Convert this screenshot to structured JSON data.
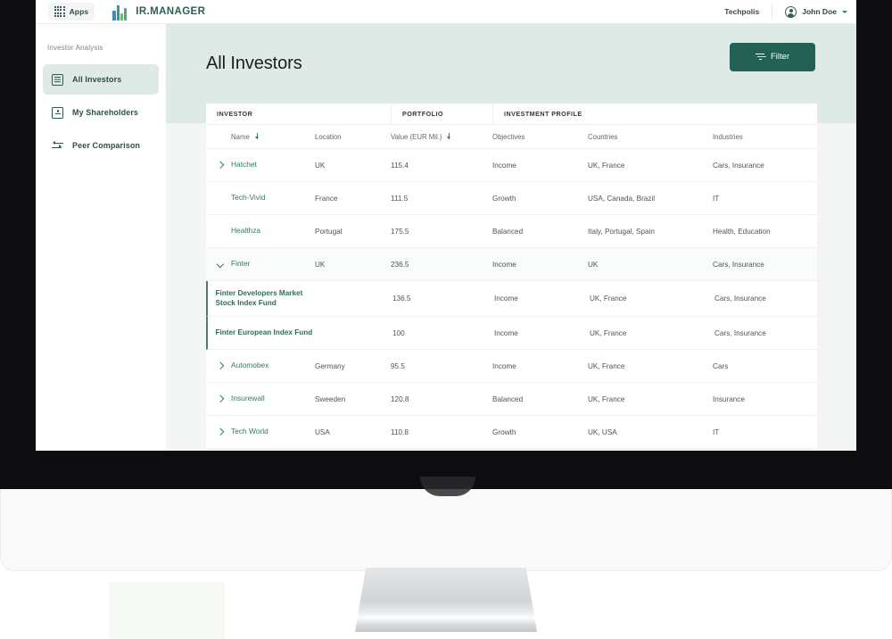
{
  "topnav": {
    "apps_label": "Apps",
    "brand_name": "IR.MANAGER",
    "org_name": "Techpolis",
    "user_name": "John Doe"
  },
  "sidebar": {
    "section_title": "Investor Analysis",
    "items": [
      {
        "label": "All Investors",
        "icon": "list-icon",
        "active": true
      },
      {
        "label": "My Shareholders",
        "icon": "document-person-icon",
        "active": false
      },
      {
        "label": "Peer Comparison",
        "icon": "compare-arrows-icon",
        "active": false
      }
    ]
  },
  "main": {
    "page_title": "All Investors",
    "filter_button": "Filter"
  },
  "table": {
    "group_headers": [
      "INVESTOR",
      "PORTFOLIO",
      "INVESTMENT PROFILE"
    ],
    "columns": [
      {
        "label": "Name",
        "sortable": true
      },
      {
        "label": "Location",
        "sortable": false
      },
      {
        "label": "Value (EUR Mil.)",
        "sortable": true
      },
      {
        "label": "Objectives",
        "sortable": false
      },
      {
        "label": "Countries",
        "sortable": false
      },
      {
        "label": "Industries",
        "sortable": false
      }
    ],
    "rows": [
      {
        "name": "Hatchet",
        "location": "UK",
        "value": "115.4",
        "objectives": "Income",
        "countries": "UK, France",
        "industries": "Cars, Insurance",
        "state": "collapsed",
        "level": 0
      },
      {
        "name": "Tech-Vivid",
        "location": "France",
        "value": "111.5",
        "objectives": "Growth",
        "countries": "USA, Canada, Brazil",
        "industries": "IT",
        "state": "none",
        "level": 0
      },
      {
        "name": "Healthza",
        "location": "Portugal",
        "value": "175.5",
        "objectives": "Balanced",
        "countries": "Italy, Portugal, Spain",
        "industries": "Health, Education",
        "state": "none",
        "level": 0
      },
      {
        "name": "Finter",
        "location": "UK",
        "value": "236.5",
        "objectives": "Income",
        "countries": "UK",
        "industries": "Cars, Insurance",
        "state": "expanded",
        "level": 0
      },
      {
        "name": "Finter Developers Market Stock Index Fund",
        "location": "",
        "value": "136.5",
        "objectives": "Income",
        "countries": "UK, France",
        "industries": "Cars, Insurance",
        "state": "none",
        "level": 1
      },
      {
        "name": "Finter European Index Fund",
        "location": "",
        "value": "100",
        "objectives": "Income",
        "countries": "UK, France",
        "industries": "Cars, Insurance",
        "state": "none",
        "level": 1
      },
      {
        "name": "Automobex",
        "location": "Germany",
        "value": "95.5",
        "objectives": "Income",
        "countries": "UK, France",
        "industries": "Cars",
        "state": "collapsed",
        "level": 0
      },
      {
        "name": "Insurewall",
        "location": "Sweeden",
        "value": "120.8",
        "objectives": "Balanced",
        "countries": "UK, France",
        "industries": "Insurance",
        "state": "collapsed",
        "level": 0
      },
      {
        "name": "Tech World",
        "location": "USA",
        "value": "110.8",
        "objectives": "Growth",
        "countries": "UK, USA",
        "industries": "IT",
        "state": "collapsed",
        "level": 0
      }
    ]
  },
  "colors": {
    "accent_dark_teal": "#236155",
    "accent_link_green": "#2f7a6b",
    "hero_band": "#dfeae7",
    "page_bg": "#f4f6f5",
    "bezel": "#0d0d10"
  }
}
